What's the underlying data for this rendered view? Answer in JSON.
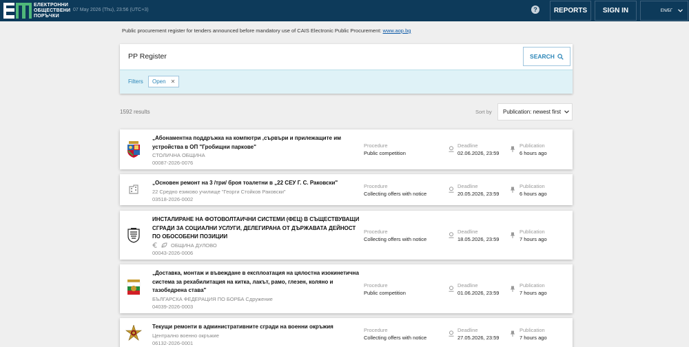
{
  "header": {
    "logo_text": [
      "ЕЛЕКТРОННИ",
      "ОБЩЕСТВЕНИ",
      "ПОРЪЧКИ"
    ],
    "datetime": "07 May 2026 (Thu), 23:56 (UTC+3)",
    "help_icon": "?",
    "reports_label": "REPORTS",
    "signin_label": "SIGN IN",
    "lang_label": "EN/БГ",
    "brand_color": "#0d3a5a"
  },
  "notice": {
    "text": "Public procurement register for tenders announced before mandatory use of CAIS Electronic Public Procurement:",
    "link": "www.aop.bg"
  },
  "register": {
    "title": "PP Register",
    "search_label": "SEARCH",
    "filters_label": "Filters",
    "filter_chip": "Open",
    "chip_remove": "✕"
  },
  "results": {
    "count_text": "1592 results",
    "sort_label": "Sort by",
    "sort_value": "Publication: newest first"
  },
  "labels": {
    "procedure": "Procedure",
    "deadline": "Deadline",
    "publication": "Publication"
  },
  "items": [
    {
      "title": "„Абонаментна поддръжка на компютри ,сървъри и прилежащите им устройства в ОП \"Гробищни паркове\"",
      "org": "СТОЛИЧНА ОБЩИНА",
      "id": "00087-2026-0076",
      "procedure": "Public competition",
      "deadline": "02.06.2026, 23:59",
      "publication": "6 hours ago",
      "logo": "sofia-coat-of-arms"
    },
    {
      "title": "„Основен ремонт на 3 /три/ броя тоалетни в „22 СЕУ Г. С. Раковски\"",
      "org": "22 Средно езиково училище \"Георги Стойков Раковски\"",
      "id": "03518-2026-0002",
      "procedure": "Collecting offers with notice",
      "deadline": "20.05.2026, 23:59",
      "publication": "6 hours ago",
      "logo": "building-icon"
    },
    {
      "title": "ИНСТАЛИРАНЕ НА ФОТОВОЛТАИЧНИ СИСТЕМИ (ФЕЦ) В СЪЩЕСТВУВАЩИ СГРАДИ ЗА СОЦИАЛНИ УСЛУГИ, ДЕЛЕГИРАНА ОТ ДЪРЖАВАТА ДЕЙНОСТ ПО ОБОСОБЕНИ ПОЗИЦИИ",
      "org": "ОБЩИНА ДУЛОВО",
      "id": "00043-2026-0006",
      "procedure": "Collecting offers with notice",
      "deadline": "18.05.2026, 23:59",
      "publication": "7 hours ago",
      "logo": "dulovo-coat-of-arms",
      "org_icons": [
        "euro-icon",
        "leaf-icon"
      ]
    },
    {
      "title": "„Доставка, монтаж и въвеждане в експлоатация на цялостна изокинетична система за рехабилитация на китка, лакът, рамо, глезен, коляно и тазобедрена става\"",
      "org": "БЪЛГАРСКА ФЕДЕРАЦИЯ ПО БОРБА Сдружение",
      "id": "04039-2026-0003",
      "procedure": "Public competition",
      "deadline": "01.06.2026, 23:59",
      "publication": "7 hours ago",
      "logo": "wrestling-federation-logo"
    },
    {
      "title": "Текущи ремонти в административните сгради на военни окръжия",
      "org": "Централно военно окръжие",
      "id": "06132-2026-0001",
      "procedure": "Collecting offers with notice",
      "deadline": "27.05.2026, 23:59",
      "publication": "7 hours ago",
      "logo": "military-emblem"
    }
  ]
}
